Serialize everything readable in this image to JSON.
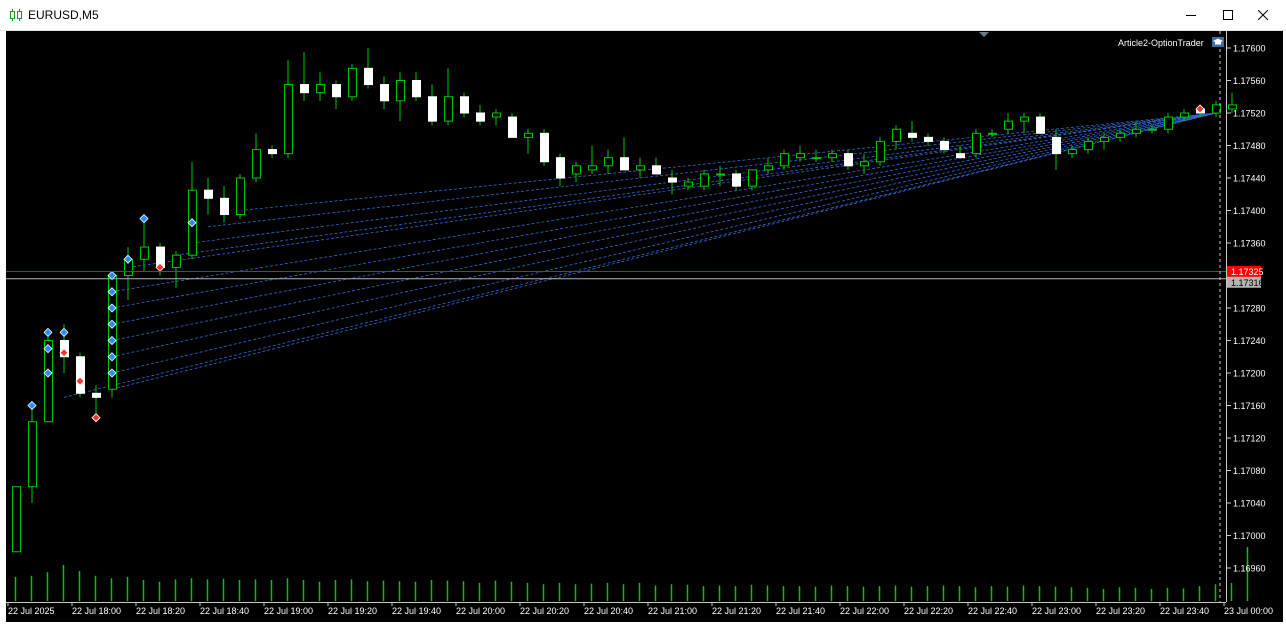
{
  "window": {
    "title": "EURUSD,M5",
    "controls": [
      "minimize-icon",
      "maximize-icon",
      "close-icon"
    ]
  },
  "chart": {
    "expert_label": "Article2-OptionTrader",
    "expert_icon": "graduation-cap-icon",
    "background": "#000000",
    "bull_border": "#00c800",
    "candle_color": "#ffffff",
    "volume_color": "#00c800",
    "price_axis": {
      "labels": [
        "1.17600",
        "1.17560",
        "1.17520",
        "1.17480",
        "1.17440",
        "1.17400",
        "1.17360",
        "1.17280",
        "1.17240",
        "1.17200",
        "1.17160",
        "1.17120",
        "1.17080",
        "1.17040",
        "1.17000",
        "1.16960"
      ]
    },
    "ask_line": {
      "price": "1.17325",
      "color": "#ff0000"
    },
    "bid_line": {
      "price": "1.17316",
      "color": "#b4b4b4"
    },
    "time_axis": {
      "labels": [
        "22 Jul 2025",
        "22 Jul 18:00",
        "22 Jul 18:20",
        "22 Jul 18:40",
        "22 Jul 19:00",
        "22 Jul 19:20",
        "22 Jul 19:40",
        "22 Jul 20:00",
        "22 Jul 20:20",
        "22 Jul 20:40",
        "22 Jul 21:00",
        "22 Jul 21:20",
        "22 Jul 21:40",
        "22 Jul 22:00",
        "22 Jul 22:20",
        "22 Jul 22:40",
        "22 Jul 23:00",
        "22 Jul 23:20",
        "22 Jul 23:40",
        "23 Jul 00:00"
      ]
    },
    "candles": [
      {
        "o": 1.1698,
        "h": 1.1706,
        "l": 1.1698,
        "c": 1.1706
      },
      {
        "o": 1.1706,
        "h": 1.1716,
        "l": 1.1704,
        "c": 1.1714
      },
      {
        "o": 1.1714,
        "h": 1.1725,
        "l": 1.1714,
        "c": 1.1724
      },
      {
        "o": 1.1724,
        "h": 1.1726,
        "l": 1.172,
        "c": 1.1722
      },
      {
        "o": 1.1722,
        "h": 1.17225,
        "l": 1.1717,
        "c": 1.17175
      },
      {
        "o": 1.17175,
        "h": 1.17185,
        "l": 1.1715,
        "c": 1.1717
      },
      {
        "o": 1.1718,
        "h": 1.1732,
        "l": 1.1717,
        "c": 1.1732
      },
      {
        "o": 1.1732,
        "h": 1.17355,
        "l": 1.1729,
        "c": 1.1734
      },
      {
        "o": 1.1734,
        "h": 1.17385,
        "l": 1.17325,
        "c": 1.17355
      },
      {
        "o": 1.17355,
        "h": 1.1736,
        "l": 1.1732,
        "c": 1.1733
      },
      {
        "o": 1.1733,
        "h": 1.1735,
        "l": 1.17305,
        "c": 1.17345
      },
      {
        "o": 1.17345,
        "h": 1.1746,
        "l": 1.1734,
        "c": 1.17425
      },
      {
        "o": 1.17425,
        "h": 1.1744,
        "l": 1.17395,
        "c": 1.17415
      },
      {
        "o": 1.17415,
        "h": 1.1743,
        "l": 1.17385,
        "c": 1.17395
      },
      {
        "o": 1.17395,
        "h": 1.17445,
        "l": 1.1739,
        "c": 1.1744
      },
      {
        "o": 1.1744,
        "h": 1.17495,
        "l": 1.17435,
        "c": 1.17475
      },
      {
        "o": 1.17475,
        "h": 1.1748,
        "l": 1.17465,
        "c": 1.1747
      },
      {
        "o": 1.1747,
        "h": 1.17585,
        "l": 1.17465,
        "c": 1.17555
      },
      {
        "o": 1.17555,
        "h": 1.17595,
        "l": 1.17535,
        "c": 1.17545
      },
      {
        "o": 1.17545,
        "h": 1.1757,
        "l": 1.17535,
        "c": 1.17555
      },
      {
        "o": 1.17555,
        "h": 1.1756,
        "l": 1.17525,
        "c": 1.1754
      },
      {
        "o": 1.1754,
        "h": 1.1758,
        "l": 1.17535,
        "c": 1.17575
      },
      {
        "o": 1.17575,
        "h": 1.176,
        "l": 1.1755,
        "c": 1.17555
      },
      {
        "o": 1.17555,
        "h": 1.17565,
        "l": 1.17525,
        "c": 1.17535
      },
      {
        "o": 1.17535,
        "h": 1.1757,
        "l": 1.1751,
        "c": 1.1756
      },
      {
        "o": 1.1756,
        "h": 1.1757,
        "l": 1.17535,
        "c": 1.1754
      },
      {
        "o": 1.1754,
        "h": 1.17555,
        "l": 1.17505,
        "c": 1.1751
      },
      {
        "o": 1.1751,
        "h": 1.17575,
        "l": 1.17505,
        "c": 1.1754
      },
      {
        "o": 1.1754,
        "h": 1.17545,
        "l": 1.17515,
        "c": 1.1752
      },
      {
        "o": 1.1752,
        "h": 1.1753,
        "l": 1.17505,
        "c": 1.1751
      },
      {
        "o": 1.17515,
        "h": 1.17525,
        "l": 1.17505,
        "c": 1.1752
      },
      {
        "o": 1.17515,
        "h": 1.1752,
        "l": 1.1749,
        "c": 1.1749
      },
      {
        "o": 1.1749,
        "h": 1.175,
        "l": 1.1747,
        "c": 1.17495
      },
      {
        "o": 1.17495,
        "h": 1.175,
        "l": 1.17455,
        "c": 1.1746
      },
      {
        "o": 1.17465,
        "h": 1.1747,
        "l": 1.1743,
        "c": 1.1744
      },
      {
        "o": 1.17445,
        "h": 1.1746,
        "l": 1.17435,
        "c": 1.17455
      },
      {
        "o": 1.1745,
        "h": 1.1748,
        "l": 1.17445,
        "c": 1.17455
      },
      {
        "o": 1.17455,
        "h": 1.17475,
        "l": 1.17445,
        "c": 1.17465
      },
      {
        "o": 1.17465,
        "h": 1.1749,
        "l": 1.17455,
        "c": 1.1745
      },
      {
        "o": 1.1745,
        "h": 1.17465,
        "l": 1.1744,
        "c": 1.17455
      },
      {
        "o": 1.17455,
        "h": 1.17465,
        "l": 1.17445,
        "c": 1.17445
      },
      {
        "o": 1.1744,
        "h": 1.1745,
        "l": 1.1742,
        "c": 1.17435
      },
      {
        "o": 1.1743,
        "h": 1.1744,
        "l": 1.17425,
        "c": 1.17435
      },
      {
        "o": 1.1743,
        "h": 1.1745,
        "l": 1.17425,
        "c": 1.17445
      },
      {
        "o": 1.17445,
        "h": 1.17455,
        "l": 1.1743,
        "c": 1.17445
      },
      {
        "o": 1.17445,
        "h": 1.1745,
        "l": 1.17425,
        "c": 1.1743
      },
      {
        "o": 1.1743,
        "h": 1.1745,
        "l": 1.17425,
        "c": 1.1745
      },
      {
        "o": 1.1745,
        "h": 1.17465,
        "l": 1.17445,
        "c": 1.17455
      },
      {
        "o": 1.17455,
        "h": 1.17475,
        "l": 1.1745,
        "c": 1.1747
      },
      {
        "o": 1.17465,
        "h": 1.1748,
        "l": 1.1746,
        "c": 1.1747
      },
      {
        "o": 1.17465,
        "h": 1.17475,
        "l": 1.1746,
        "c": 1.17465
      },
      {
        "o": 1.17465,
        "h": 1.17475,
        "l": 1.1746,
        "c": 1.1747
      },
      {
        "o": 1.1747,
        "h": 1.17475,
        "l": 1.1745,
        "c": 1.17455
      },
      {
        "o": 1.17455,
        "h": 1.1747,
        "l": 1.17445,
        "c": 1.1746
      },
      {
        "o": 1.1746,
        "h": 1.1749,
        "l": 1.17455,
        "c": 1.17485
      },
      {
        "o": 1.17485,
        "h": 1.17505,
        "l": 1.17475,
        "c": 1.175
      },
      {
        "o": 1.17495,
        "h": 1.1751,
        "l": 1.17485,
        "c": 1.1749
      },
      {
        "o": 1.1749,
        "h": 1.17495,
        "l": 1.1748,
        "c": 1.17485
      },
      {
        "o": 1.17485,
        "h": 1.1749,
        "l": 1.1747,
        "c": 1.17475
      },
      {
        "o": 1.1747,
        "h": 1.1748,
        "l": 1.17465,
        "c": 1.17465
      },
      {
        "o": 1.1747,
        "h": 1.175,
        "l": 1.17465,
        "c": 1.17495
      },
      {
        "o": 1.17495,
        "h": 1.175,
        "l": 1.1749,
        "c": 1.17495
      },
      {
        "o": 1.175,
        "h": 1.1752,
        "l": 1.17495,
        "c": 1.1751
      },
      {
        "o": 1.1751,
        "h": 1.1752,
        "l": 1.17495,
        "c": 1.17515
      },
      {
        "o": 1.17515,
        "h": 1.1752,
        "l": 1.17495,
        "c": 1.17495
      },
      {
        "o": 1.1749,
        "h": 1.175,
        "l": 1.1745,
        "c": 1.1747
      },
      {
        "o": 1.1747,
        "h": 1.1748,
        "l": 1.17465,
        "c": 1.17475
      },
      {
        "o": 1.17475,
        "h": 1.1749,
        "l": 1.1747,
        "c": 1.17485
      },
      {
        "o": 1.17485,
        "h": 1.17495,
        "l": 1.17475,
        "c": 1.1749
      },
      {
        "o": 1.1749,
        "h": 1.175,
        "l": 1.17485,
        "c": 1.17495
      },
      {
        "o": 1.17495,
        "h": 1.1751,
        "l": 1.1749,
        "c": 1.175
      },
      {
        "o": 1.175,
        "h": 1.17505,
        "l": 1.17495,
        "c": 1.175
      },
      {
        "o": 1.175,
        "h": 1.1752,
        "l": 1.17495,
        "c": 1.17515
      },
      {
        "o": 1.17515,
        "h": 1.17525,
        "l": 1.1751,
        "c": 1.1752
      },
      {
        "o": 1.17525,
        "h": 1.1753,
        "l": 1.17515,
        "c": 1.1752
      },
      {
        "o": 1.1752,
        "h": 1.17535,
        "l": 1.17515,
        "c": 1.1753
      },
      {
        "o": 1.17525,
        "h": 1.17545,
        "l": 1.1752,
        "c": 1.1753
      }
    ],
    "volumes": [
      40,
      42,
      48,
      60,
      50,
      42,
      38,
      40,
      35,
      32,
      36,
      38,
      36,
      37,
      35,
      36,
      35,
      38,
      35,
      32,
      35,
      36,
      33,
      34,
      33,
      32,
      35,
      34,
      33,
      30,
      34,
      32,
      30,
      28,
      30,
      28,
      29,
      30,
      28,
      30,
      26,
      28,
      27,
      25,
      26,
      25,
      27,
      26,
      25,
      25,
      24,
      26,
      25,
      24,
      25,
      26,
      24,
      25,
      26,
      25,
      23,
      25,
      24,
      26,
      25,
      24,
      23,
      22,
      20,
      23,
      22,
      20,
      22,
      21,
      25,
      28,
      30,
      90
    ]
  }
}
